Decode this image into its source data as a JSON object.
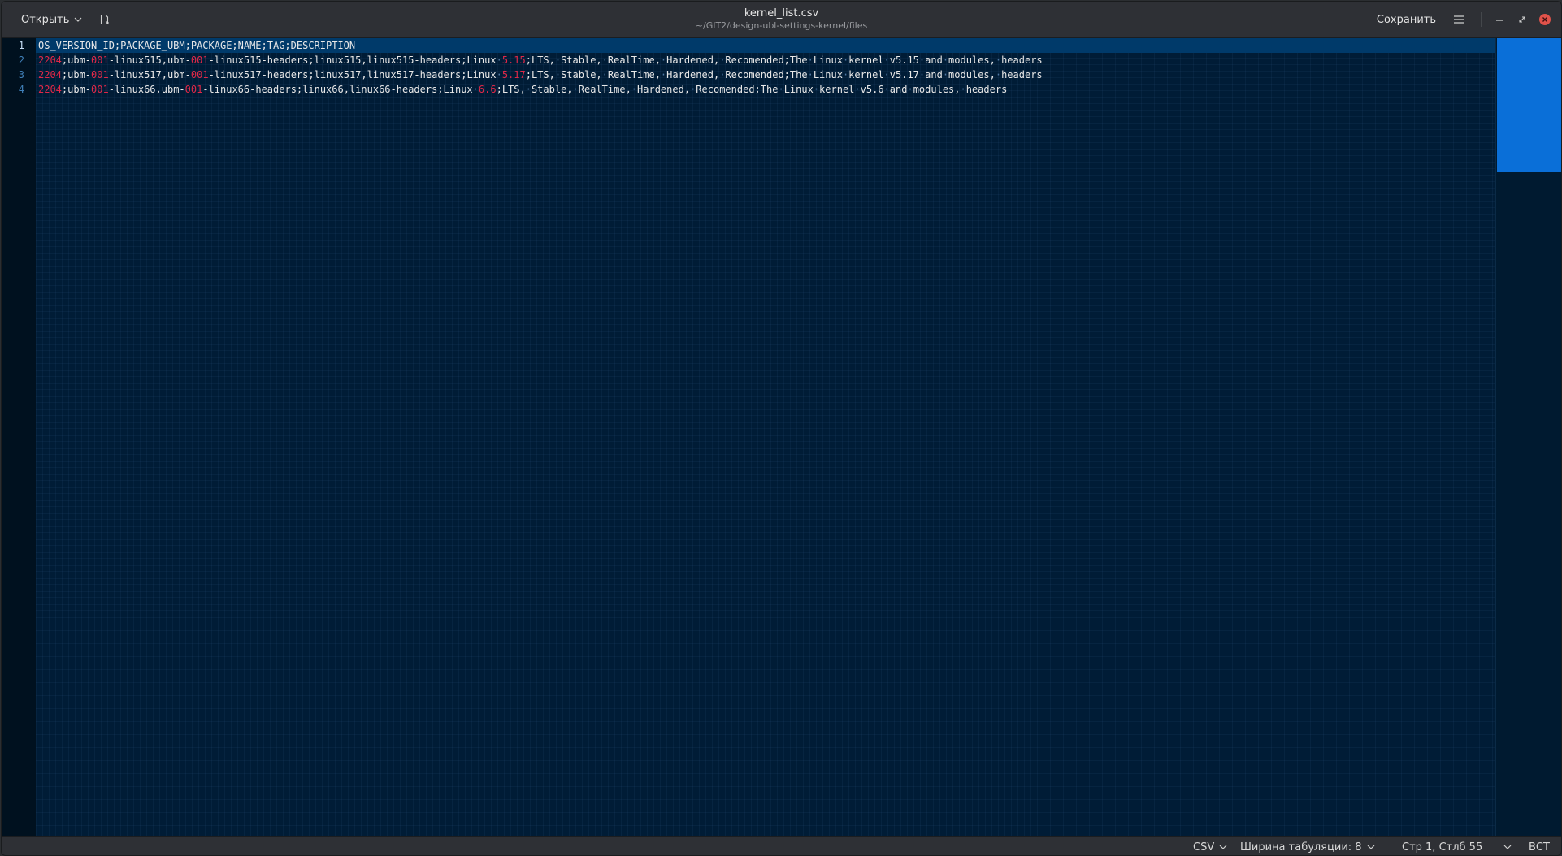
{
  "header": {
    "open_label": "Открыть",
    "title": "kernel_list.csv",
    "subtitle": "~/GIT2/design-ubl-settings-kernel/files",
    "save_label": "Сохранить"
  },
  "icons": {
    "open_menu": "chevron-down-icon",
    "new_document": "new-document-icon",
    "app_menu": "hamburger-menu-icon",
    "minimize": "minimize-icon",
    "maximize": "maximize-icon",
    "close": "close-icon"
  },
  "colors": {
    "editor_bg": "#001c36",
    "current_line": "#003a6a",
    "number_highlight": "#e02848",
    "overview_thumb": "#0a6fd8",
    "close_button": "#e0524a"
  },
  "editor": {
    "line_numbers": [
      "1",
      "2",
      "3",
      "4"
    ],
    "current_line": 1,
    "lines": [
      "OS_VERSION_ID;PACKAGE_UBM;PACKAGE;NAME;TAG;DESCRIPTION",
      "2204;ubm-001-linux515,ubm-001-linux515-headers;linux515,linux515-headers;Linux 5.15;LTS, Stable, RealTime, Hardened, Recomended;The Linux kernel v5.15 and modules, headers",
      "2204;ubm-001-linux517,ubm-001-linux517-headers;linux517,linux517-headers;Linux 5.17;LTS, Stable, RealTime, Hardened, Recomended;The Linux kernel v5.17 and modules, headers",
      "2204;ubm-001-linux66,ubm-001-linux66-headers;linux66,linux66-headers;Linux 6.6;LTS, Stable, RealTime, Hardened, Recomended;The Linux kernel v5.6 and modules, headers"
    ]
  },
  "statusbar": {
    "language": "CSV",
    "tab_width": "Ширина табуляции: 8",
    "position": "Стр 1, Стлб 55",
    "insert_mode": "ВСТ"
  }
}
